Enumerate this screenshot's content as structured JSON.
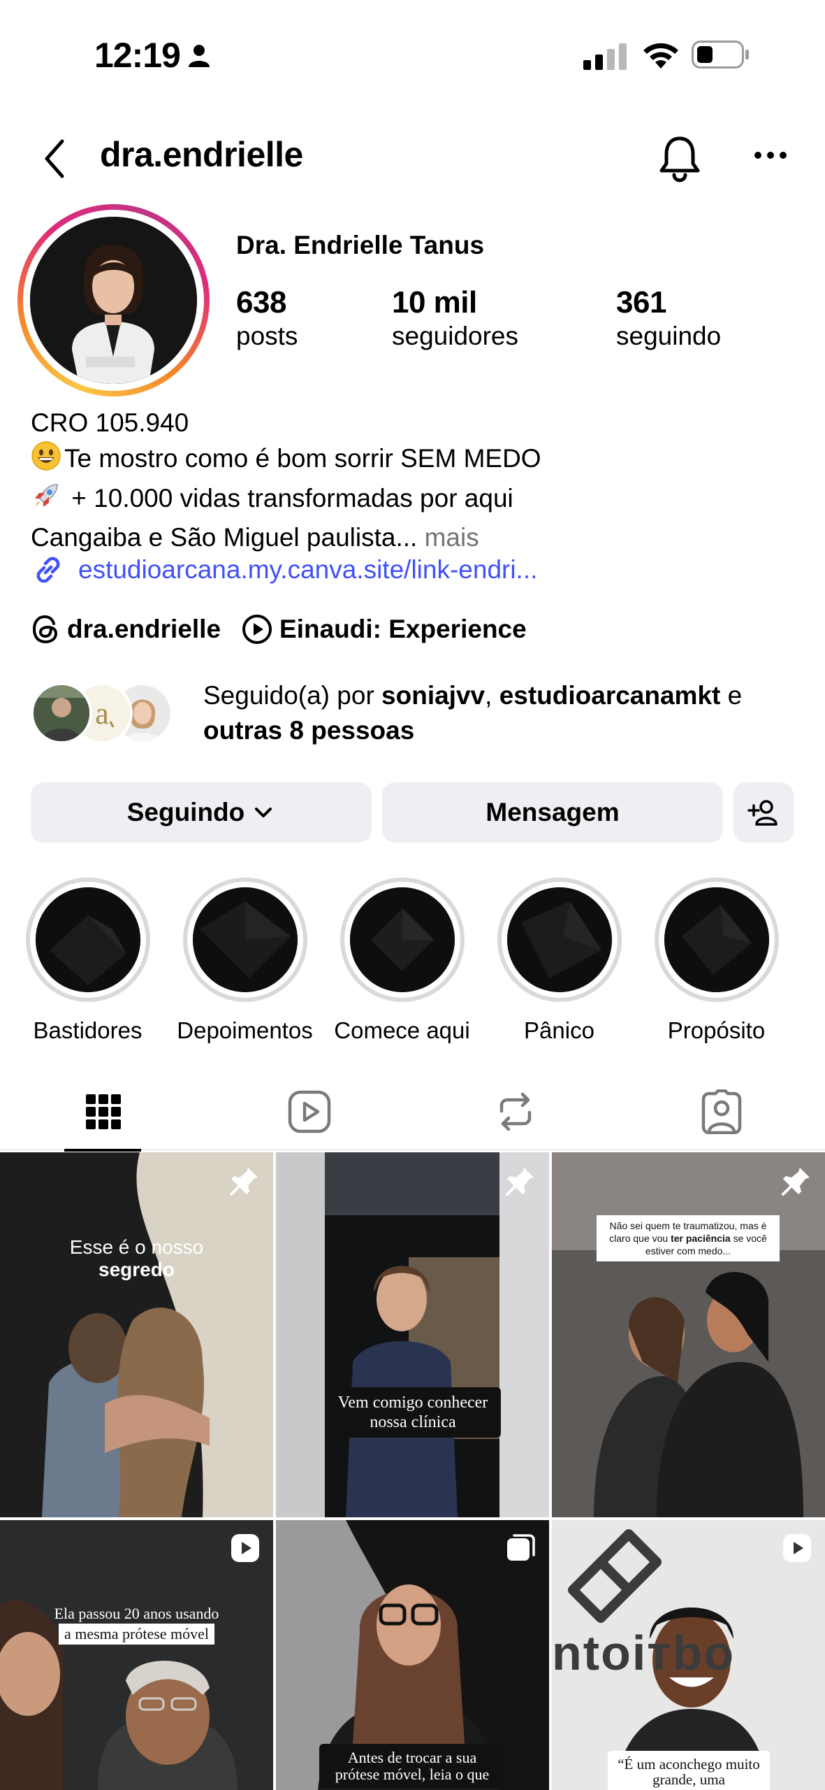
{
  "status_bar": {
    "time": "12:19"
  },
  "header": {
    "username": "dra.endrielle"
  },
  "profile": {
    "display_name": "Dra. Endrielle Tanus",
    "stats": [
      {
        "value": "638",
        "label": "posts"
      },
      {
        "value": "10 mil",
        "label": "seguidores"
      },
      {
        "value": "361",
        "label": "seguindo"
      }
    ],
    "bio": {
      "line1": "CRO 105.940",
      "line2_emoji": "😀",
      "line2": "Te mostro como é bom sorrir SEM MEDO",
      "line3_emoji": "🚀",
      "line3": " + 10.000 vidas transformadas por aqui",
      "line4": "Cangaiba e São Miguel paulista... ",
      "more": "mais"
    },
    "link": "estudioarcana.my.canva.site/link-endri...",
    "threads_handle": "dra.endrielle",
    "music": "Einaudi: Experience",
    "followed_by": {
      "prefix": "Seguido(a) por ",
      "user1": "soniajvv",
      "sep": ", ",
      "user2": "estudioarcanamkt",
      "conj": " e",
      "others": "outras 8 pessoas"
    }
  },
  "buttons": {
    "following": "Seguindo",
    "message": "Mensagem"
  },
  "highlights": [
    {
      "label": "Bastidores"
    },
    {
      "label": "Depoimentos"
    },
    {
      "label": "Comece aqui"
    },
    {
      "label": "Pânico"
    },
    {
      "label": "Propósito"
    }
  ],
  "tabs": [
    "grid-icon",
    "reels-icon",
    "reposts-icon",
    "tagged-icon"
  ],
  "posts": [
    {
      "caption_a": "Esse é o nosso",
      "caption_b": "segredo",
      "badge": "pin-icon"
    },
    {
      "caption": "Vem comigo conhecer nossa clínica",
      "badge": "pin-icon"
    },
    {
      "caption_a": "Não sei quem te traumatizou, mas é claro que vou ",
      "caption_bold": "ter paciência",
      "caption_b": " se você estiver com medo...",
      "badge": "pin-icon"
    },
    {
      "caption_a": "Ela passou 20 anos usando",
      "caption_b": "a mesma prótese móvel",
      "badge": "reel-icon"
    },
    {
      "caption": "Antes de trocar a sua prótese móvel, leia o que",
      "badge": "carousel-icon"
    },
    {
      "caption": "“É um aconchego muito grande, uma",
      "wall_text": "ntoiтbo",
      "badge": "reel-icon"
    }
  ],
  "colors": {
    "link": "#4150f7",
    "muted": "#737373",
    "button_bg": "#efeff3"
  }
}
